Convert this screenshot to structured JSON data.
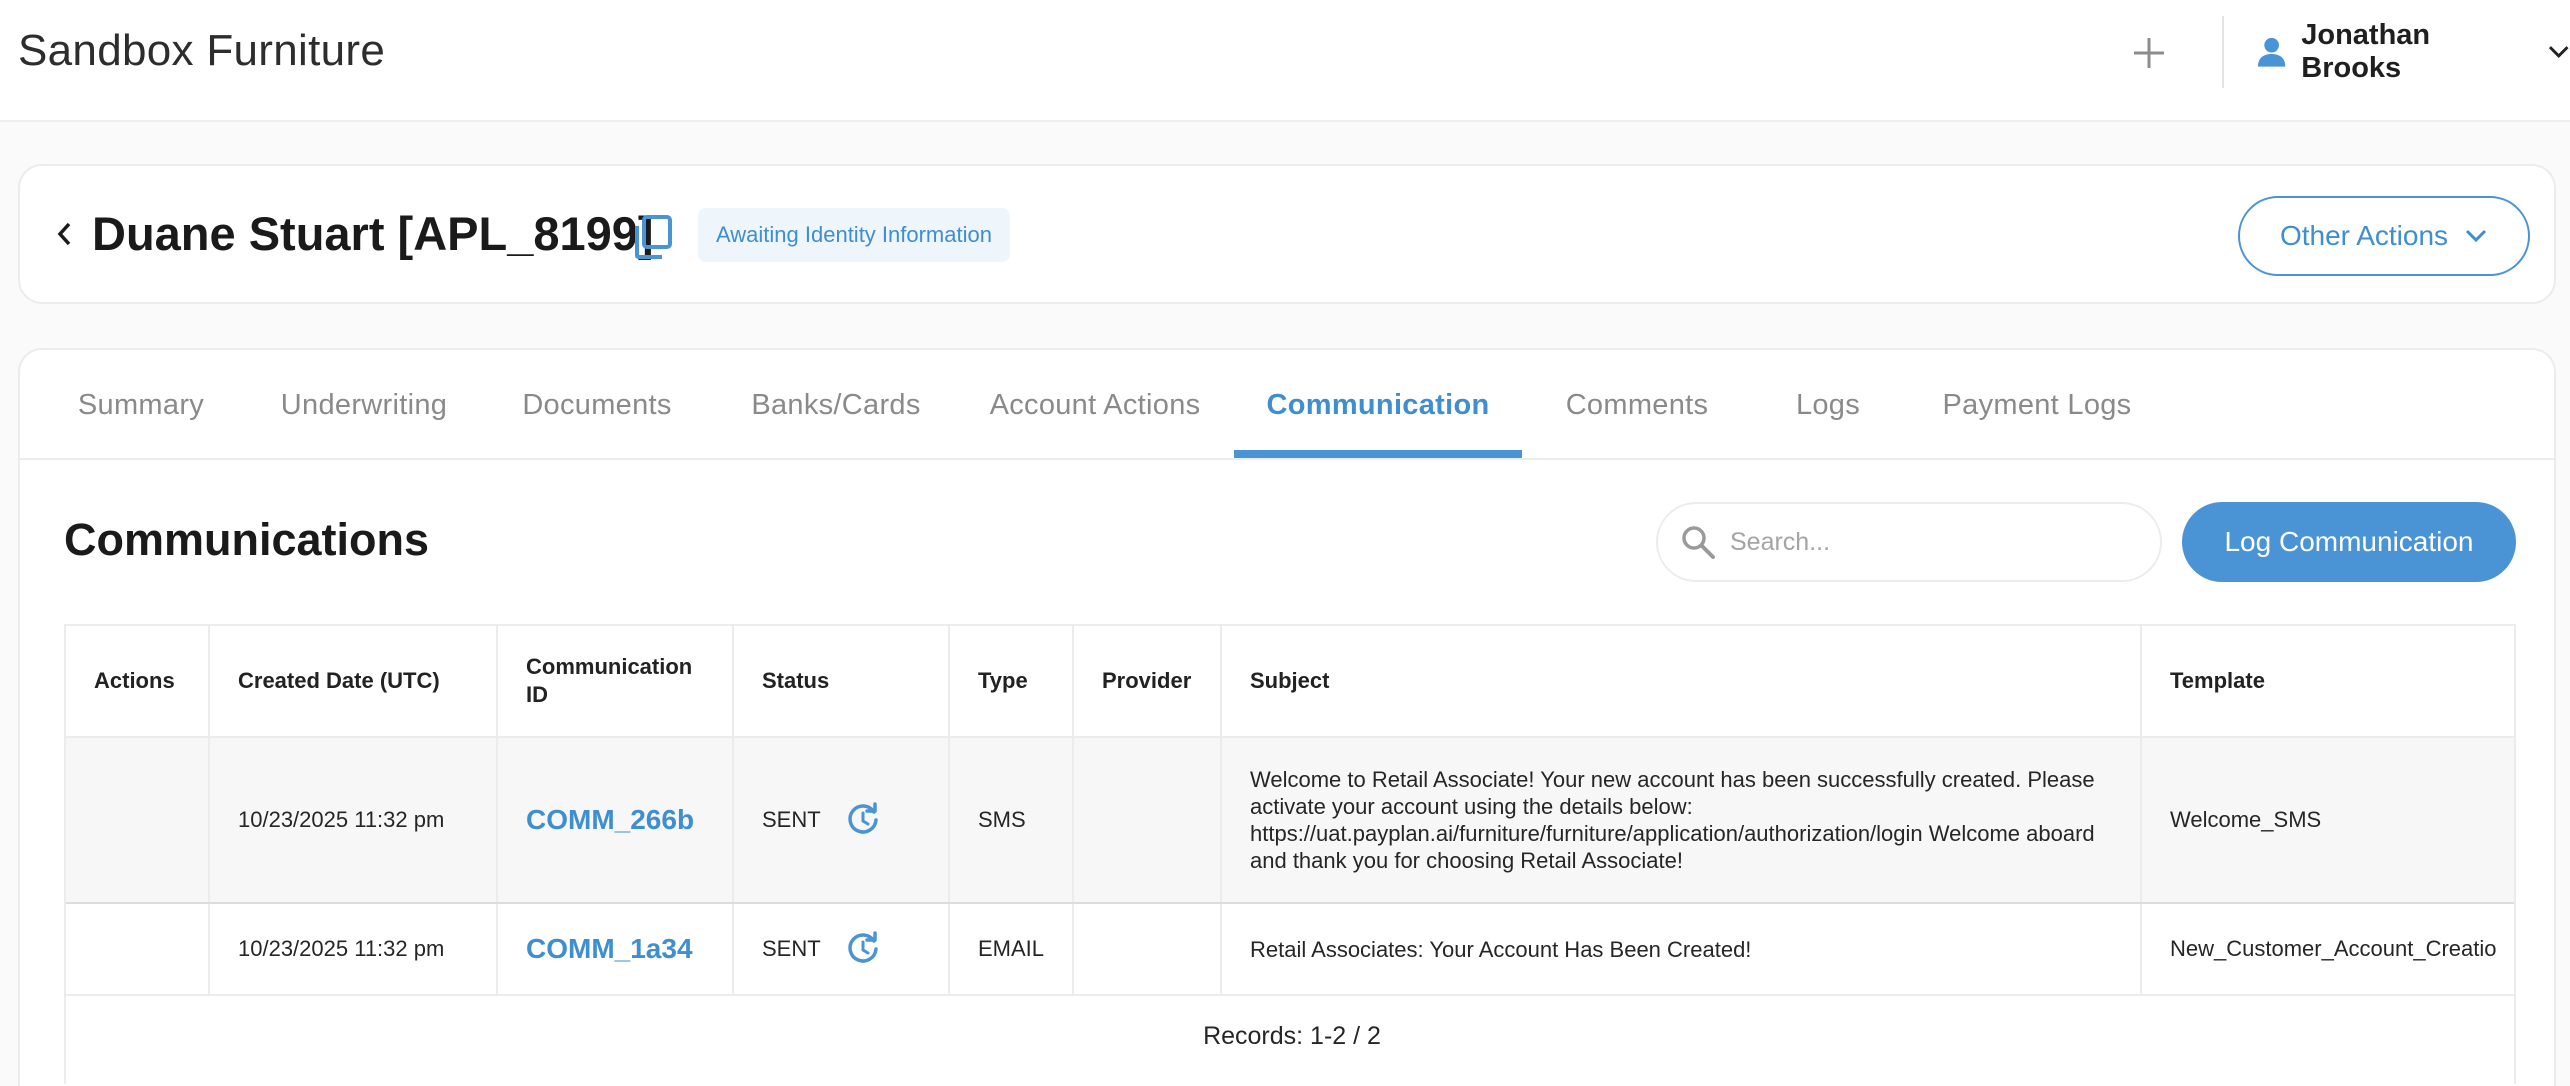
{
  "app": {
    "title": "Sandbox Furniture"
  },
  "user": {
    "name": "Jonathan Brooks"
  },
  "applicant": {
    "title": "Duane Stuart [APL_8199]",
    "status": "Awaiting Identity Information",
    "other_actions_label": "Other Actions"
  },
  "tabs": [
    {
      "label": "Summary"
    },
    {
      "label": "Underwriting"
    },
    {
      "label": "Documents"
    },
    {
      "label": "Banks/Cards"
    },
    {
      "label": "Account Actions"
    },
    {
      "label": "Communication",
      "active": true
    },
    {
      "label": "Comments"
    },
    {
      "label": "Logs"
    },
    {
      "label": "Payment Logs"
    }
  ],
  "communications": {
    "title": "Communications",
    "search_placeholder": "Search...",
    "log_button": "Log Communication",
    "columns": {
      "actions": "Actions",
      "created": "Created Date (UTC)",
      "comm_id": "Communication ID",
      "status": "Status",
      "type": "Type",
      "provider": "Provider",
      "subject": "Subject",
      "template": "Template"
    },
    "rows": [
      {
        "created": "10/23/2025 11:32 pm",
        "comm_id": "COMM_266b",
        "status": "SENT",
        "type": "SMS",
        "provider": "",
        "subject": "Welcome to Retail Associate! Your new account has been successfully created. Please activate your account using the details below: https://uat.payplan.ai/furniture/furniture/application/authorization/login   Welcome aboard and thank you for choosing Retail Associate!",
        "template": "Welcome_SMS"
      },
      {
        "created": "10/23/2025 11:32 pm",
        "comm_id": "COMM_1a34",
        "status": "SENT",
        "type": "EMAIL",
        "provider": "",
        "subject": "Retail Associates: Your Account Has Been Created!",
        "template": "New_Customer_Account_Creatio"
      }
    ],
    "records_label": "Records: 1-2 / 2"
  },
  "colors": {
    "accent": "#4a94d6",
    "accent_text": "#3e8ed0",
    "status_chip_bg": "#eef5fb"
  },
  "icons": {
    "add": "plus-icon",
    "user": "user-icon",
    "dropdown": "chevron-down-icon",
    "back": "chevron-left-icon",
    "copy": "copy-icon",
    "search": "search-icon",
    "resend": "resend-icon"
  }
}
